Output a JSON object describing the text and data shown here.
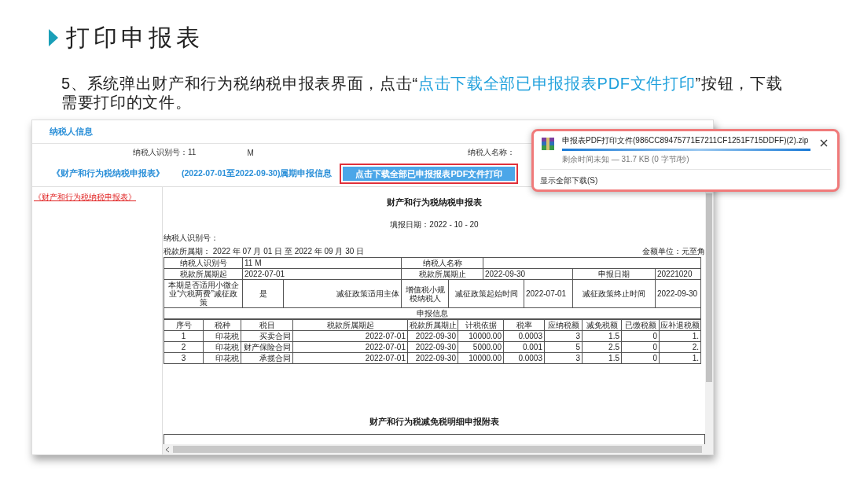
{
  "slide": {
    "title": "打印申报表",
    "instruction": {
      "before": "5、系统弹出财产和行为税纳税申报表界面，点击“",
      "highlight": "点击下载全部已申报报表PDF文件打印",
      "after": "”按钮，下载需要打印的文件。"
    }
  },
  "screen": {
    "header": "纳税人信息",
    "taxpayer_id_label": "纳税人识别号：11",
    "taxpayer_id_suffix": "M",
    "taxpayer_name_label": "纳税人名称：",
    "report_title": "《财产和行为税纳税申报表》",
    "period_info": "(2022-07-01至2022-09-30)属期申报信息",
    "download_button": {
      "label": "点击下载全部已申报报表PDF文件打印",
      "highlighted": true
    },
    "sidebar": {
      "items": [
        {
          "label": "《财产和行为税纳税申报表》",
          "selected": true
        }
      ]
    },
    "document": {
      "title": "财产和行为税纳税申报表",
      "fill_date": "填报日期：2022 - 10 - 20",
      "taxpayer_id": "纳税人识别号：",
      "period": "税款所属期： 2022 年 07 月 01 日 至 2022 年 09 月 30 日",
      "unit": "金额单位：元至角",
      "summary_rows": [
        [
          {
            "kind": "label",
            "text": "纳税人识别号"
          },
          {
            "kind": "value",
            "text": "11 M"
          },
          {
            "kind": "label",
            "text": "纳税人名称"
          },
          {
            "kind": "blank"
          }
        ],
        [
          {
            "kind": "label",
            "text": "税款所属期起"
          },
          {
            "kind": "value",
            "text": "2022-07-01"
          },
          {
            "kind": "label",
            "text": "税款所属期止"
          },
          {
            "kind": "value",
            "text": "2022-09-30"
          },
          {
            "kind": "label",
            "text": "申报日期"
          },
          {
            "kind": "value",
            "text": "20221020"
          }
        ],
        [
          {
            "kind": "label",
            "text": "本期是否适用小微企业“六税两费”减征政策"
          },
          {
            "kind": "label",
            "text": "是"
          },
          {
            "kind": "right",
            "text": "减征政策适用主体"
          },
          {
            "kind": "label",
            "text": "增值税小规模纳税人"
          },
          {
            "kind": "label",
            "text": "减征政策起始时间"
          },
          {
            "kind": "value",
            "text": "2022-07-01"
          },
          {
            "kind": "label",
            "text": "减征政策终止时间"
          },
          {
            "kind": "value",
            "text": "2022-09-30"
          }
        ],
        [
          {
            "kind": "label",
            "text": "申报信息"
          }
        ]
      ],
      "columns": [
        "序号",
        "税种",
        "税目",
        "税款所属期起",
        "税款所属期止",
        "计税依据",
        "税率",
        "应纳税额",
        "减免税额",
        "已缴税额",
        "应补退税额"
      ],
      "rows": [
        [
          "1",
          "印花税",
          "买卖合同",
          "2022-07-01",
          "2022-09-30",
          "10000.00",
          "0.0003",
          "3",
          "1.5",
          "0",
          "1."
        ],
        [
          "2",
          "印花税",
          "财产保险合同",
          "2022-07-01",
          "2022-09-30",
          "5000.00",
          "0.001",
          "5",
          "2.5",
          "0",
          "2."
        ],
        [
          "3",
          "印花税",
          "承揽合同",
          "2022-07-01",
          "2022-09-30",
          "10000.00",
          "0.0003",
          "3",
          "1.5",
          "0",
          "1."
        ]
      ],
      "appendix_title": "财产和行为税减免税明细申报附表"
    }
  },
  "download_popup": {
    "highlighted": true,
    "filename": "申报表PDF打印文件(986CC89475771E7211CF1251F715DDFF)(2).zip",
    "level": 1,
    "status": "剩余时间未知 — 31.7 KB (0 字节/秒)",
    "show_all": "显示全部下载(S)"
  }
}
